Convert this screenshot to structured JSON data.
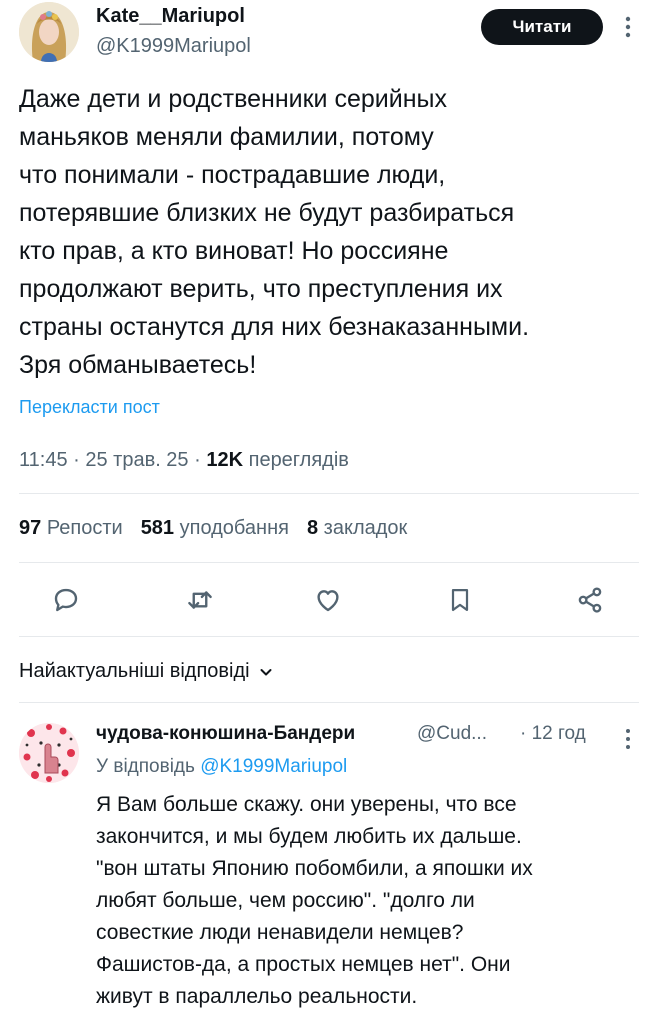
{
  "tweet": {
    "author_name": "Kate__Mariupol",
    "author_handle": "@K1999Mariupol",
    "follow_label": "Читати",
    "text": "Даже дети и родственники серийных\nманьяков меняли фамилии, потому\nчто понимали - пострадавшие люди,\nпотерявшие близких не будут разбираться\nкто прав, а кто виноват! Но россияне\nпродолжают верить, что преступления их\nстраны останутся для них безнаказанными.\nЗря обманываетесь!",
    "translate_label": "Перекласти пост",
    "time": "11:45",
    "date": "25 трав. 25",
    "views_count": "12K",
    "views_label": "переглядів",
    "reposts_count": "97",
    "reposts_label": "Репости",
    "likes_count": "581",
    "likes_label": "уподобання",
    "bookmarks_count": "8",
    "bookmarks_label": "закладок"
  },
  "actions": {
    "icons": [
      "reply-icon",
      "retweet-icon",
      "like-icon",
      "bookmark-icon",
      "share-icon"
    ]
  },
  "replies": {
    "header_label": "Найактуальніші відповіді",
    "items": [
      {
        "name": "чудова-конюшина-Бандери",
        "handle": "@Cud...",
        "time": "· 12 год",
        "replying_prefix": "У відповідь",
        "replying_to": "@K1999Mariupol",
        "text": "Я Вам больше скажу. они уверены, что все\nзакончится, и мы будем любить их дальше.\n\"вон штаты Японию побомбили, а япошки их\nлюбят больше, чем россию\". \"долго ли\nсовесткие люди ненавидели немцев?\nФашистов-да, а простых немцев нет\". Они\nживут в параллельо реальности."
      }
    ]
  },
  "colors": {
    "text": "#0f1419",
    "secondary": "#536471",
    "link": "#1d9bf0",
    "divider": "#e6e9ec",
    "button_bg": "#0f1419"
  }
}
